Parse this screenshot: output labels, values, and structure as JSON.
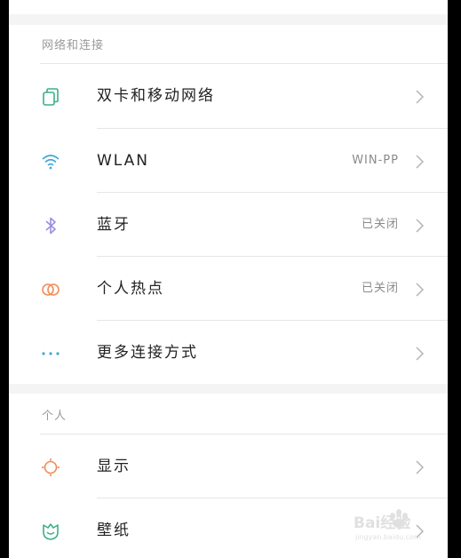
{
  "sections": [
    {
      "header": "网络和连接",
      "items": [
        {
          "label": "双卡和移动网络",
          "value": "",
          "icon": "sim-card-icon"
        },
        {
          "label": "WLAN",
          "value": "WIN-PP",
          "icon": "wifi-icon"
        },
        {
          "label": "蓝牙",
          "value": "已关闭",
          "icon": "bluetooth-icon"
        },
        {
          "label": "个人热点",
          "value": "已关闭",
          "icon": "hotspot-icon"
        },
        {
          "label": "更多连接方式",
          "value": "",
          "icon": "more-dots-icon"
        }
      ]
    },
    {
      "header": "个人",
      "items": [
        {
          "label": "显示",
          "value": "",
          "icon": "sun-icon"
        },
        {
          "label": "壁纸",
          "value": "",
          "icon": "tulip-icon"
        }
      ]
    }
  ],
  "watermark": {
    "brand": "Bai经验",
    "sub": "jingyan.baidu.com"
  },
  "colors": {
    "sim": "#3cae8c",
    "wifi": "#3fa7d6",
    "bluetooth": "#9b8fe0",
    "hotspot": "#f08c5a",
    "dots": "#3fa7d6",
    "sun": "#f08c5a",
    "tulip": "#3cae8c"
  }
}
